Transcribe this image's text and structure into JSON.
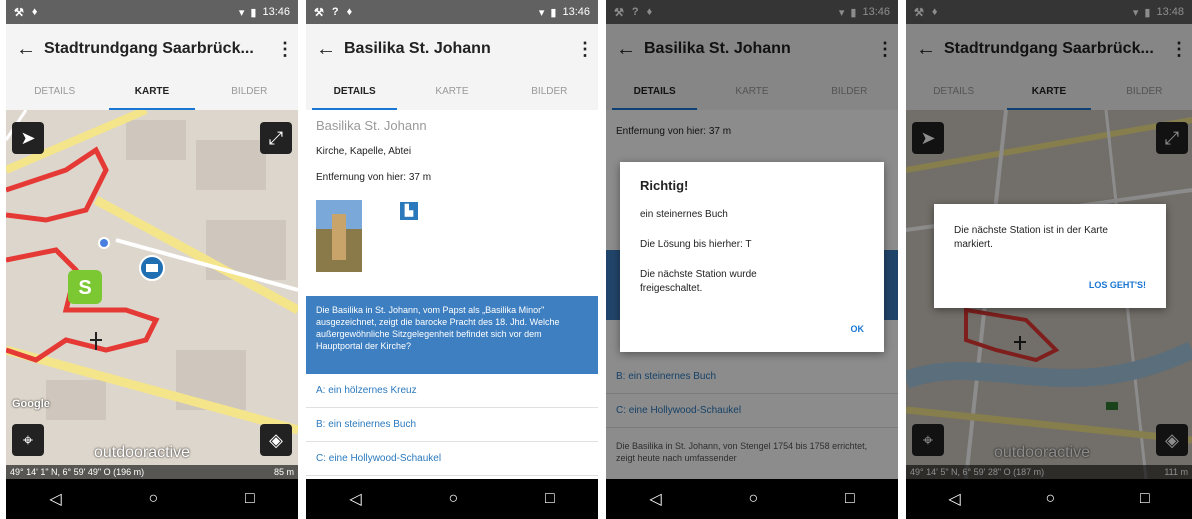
{
  "status_time": "13:46",
  "status_time_4": "13:48",
  "phone1": {
    "title": "Stadtrundgang Saarbrück...",
    "tabs": [
      "DETAILS",
      "KARTE",
      "BILDER"
    ],
    "map_coords": "49° 14' 1\" N, 6° 59' 49\" O (196 m)",
    "map_scale": "85 m",
    "watermark": "outdooractive",
    "google": "Google"
  },
  "phone2": {
    "title": "Basilika St. Johann",
    "tabs": [
      "DETAILS",
      "KARTE",
      "BILDER"
    ],
    "poi_title": "Basilika St. Johann",
    "category": "Kirche, Kapelle, Abtei",
    "distance": "Entfernung von hier: 37 m",
    "question": "Die Basilika in St. Johann, vom Papst als „Basilika Minor\" ausgezeichnet, zeigt die barocke Pracht des 18. Jhd. Welche außergewöhnliche Sitzgelegenheit befindet sich vor dem Hauptportal der Kirche?",
    "answers": [
      "A: ein hölzernes Kreuz",
      "B: ein steinernes Buch",
      "C: eine Hollywood-Schaukel"
    ]
  },
  "phone3": {
    "title": "Basilika St. Johann",
    "tabs": [
      "DETAILS",
      "KARTE",
      "BILDER"
    ],
    "bg_distance": "Entfernung von hier: 37 m",
    "bg_answer_b": "B: ein steinernes Buch",
    "bg_answer_c": "C: eine Hollywood-Schaukel",
    "bg_text": "Die Basilika in St. Johann, von Stengel 1754 bis 1758 errichtet, zeigt heute nach umfassender",
    "dialog": {
      "title": "Richtig!",
      "line1": "ein steinernes Buch",
      "line2": "Die Lösung bis hierher: T",
      "line3": "Die nächste Station wurde freigeschaltet.",
      "ok": "OK"
    }
  },
  "phone4": {
    "title": "Stadtrundgang Saarbrück...",
    "tabs": [
      "DETAILS",
      "KARTE",
      "BILDER"
    ],
    "map_coords": "49° 14' 5\" N, 6° 59' 28\" O (187 m)",
    "map_scale": "111 m",
    "watermark": "outdooractive",
    "dialog": {
      "message": "Die nächste Station ist in der Karte markiert.",
      "button": "LOS GEHT'S!"
    }
  },
  "nav": {
    "back": "◁",
    "home": "○",
    "recent": "□"
  }
}
